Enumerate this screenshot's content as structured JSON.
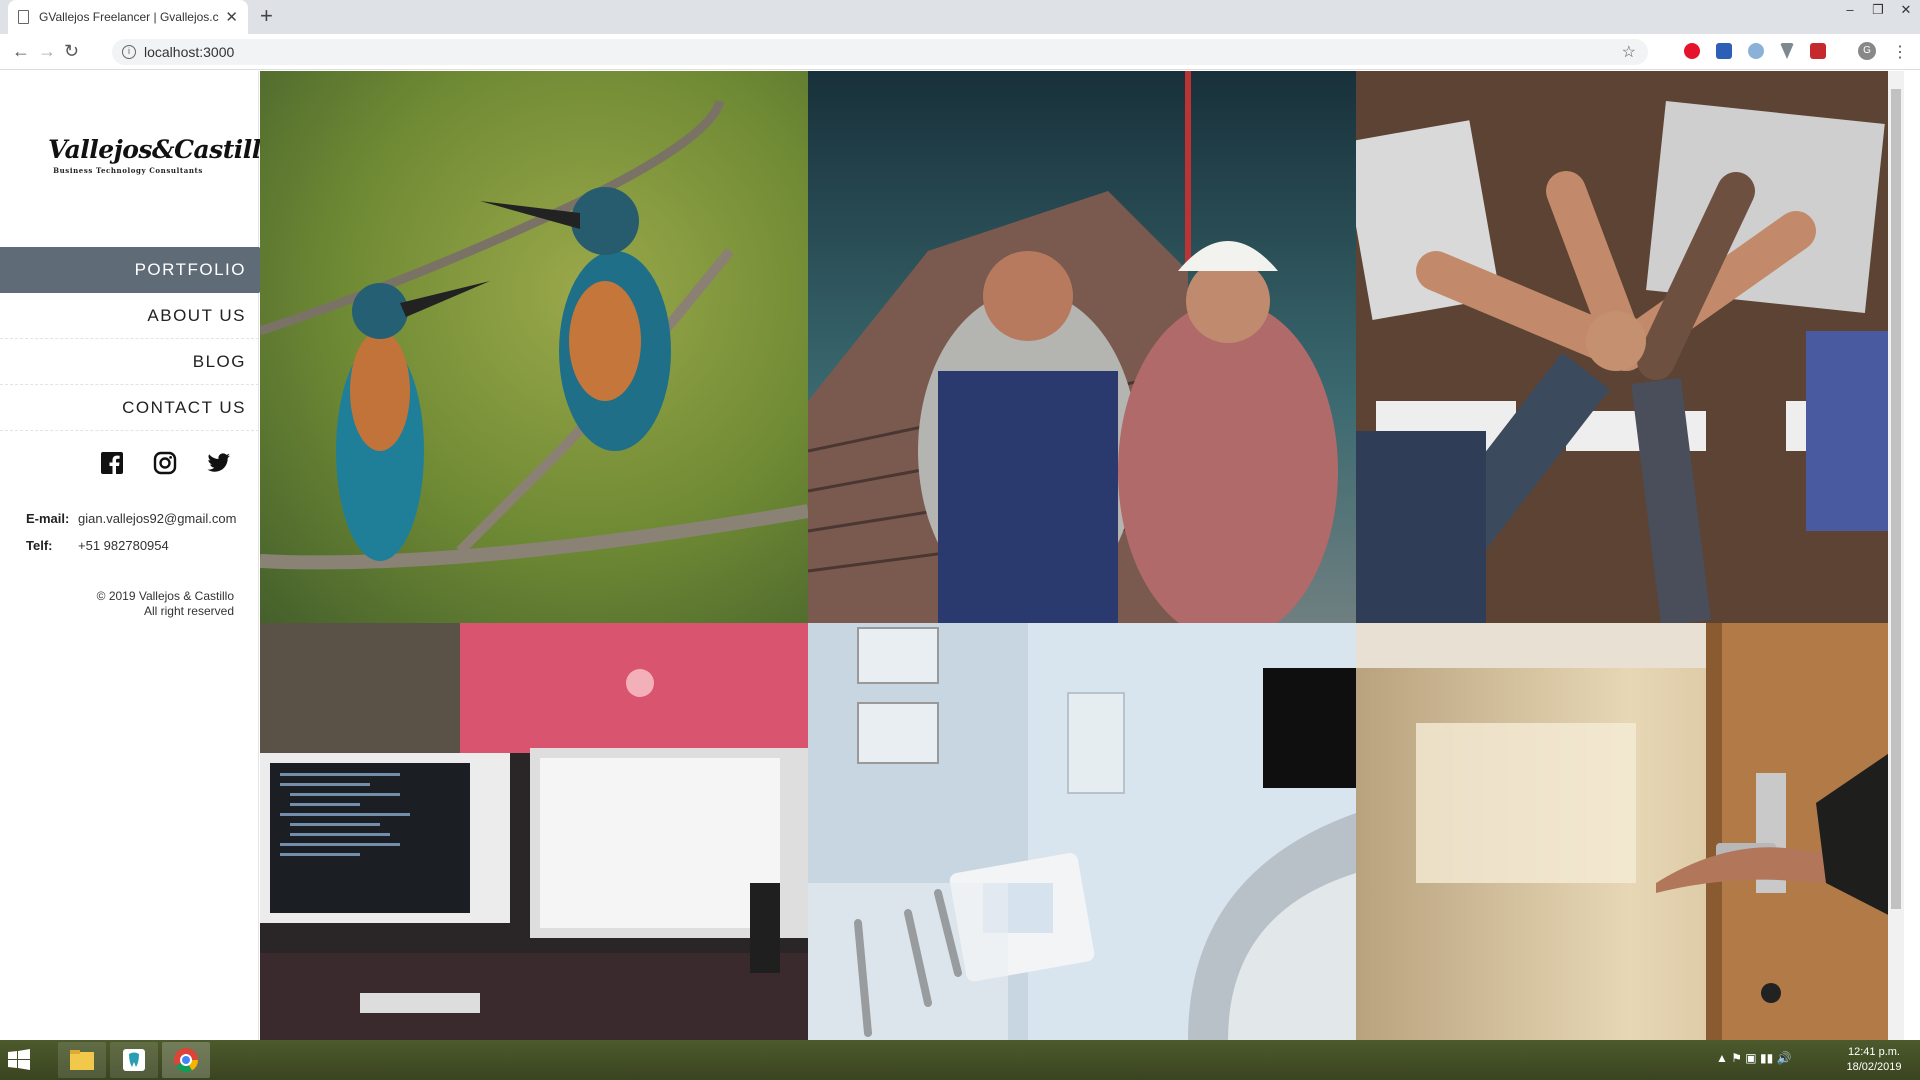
{
  "browser": {
    "tab_title": "GVallejos Freelancer | Gvallejos.c",
    "url": "localhost:3000"
  },
  "site": {
    "logo_name": "Vallejos&Castillo",
    "logo_tagline": "Business Technology Consultants",
    "menu": [
      {
        "label": "PORTFOLIO",
        "active": true
      },
      {
        "label": "ABOUT US"
      },
      {
        "label": "BLOG"
      },
      {
        "label": "CONTACT US"
      }
    ],
    "social_icons": [
      "facebook-icon",
      "instagram-icon",
      "twitter-icon"
    ],
    "contact": {
      "email_label": "E-mail:",
      "email": "gian.vallejos92@gmail.com",
      "phone_label": "Telf:",
      "phone": "+51 982780954"
    },
    "copyright_line1": "© 2019 Vallejos & Castillo",
    "copyright_line2": "All right reserved"
  },
  "portfolio_images": [
    {
      "subject": "two kingfisher birds on a branch",
      "colors": [
        "#7a8a2c",
        "#4d6a3a"
      ]
    },
    {
      "subject": "construction workers looking at a building",
      "colors": [
        "#2d4a52",
        "#7a5848"
      ]
    },
    {
      "subject": "team fist bump over a desk with laptops",
      "colors": [
        "#5b4436",
        "#8a6a4e"
      ]
    },
    {
      "subject": "computer monitors with code",
      "colors": [
        "#c84a64",
        "#2d2b30"
      ]
    },
    {
      "subject": "dental clinic equipment",
      "colors": [
        "#d3e2ef",
        "#7c8c9e"
      ]
    },
    {
      "subject": "hand opening a hotel room door",
      "colors": [
        "#c9b08a",
        "#6b5234"
      ]
    }
  ],
  "taskbar": {
    "time": "12:41 p.m.",
    "date": "18/02/2019"
  }
}
